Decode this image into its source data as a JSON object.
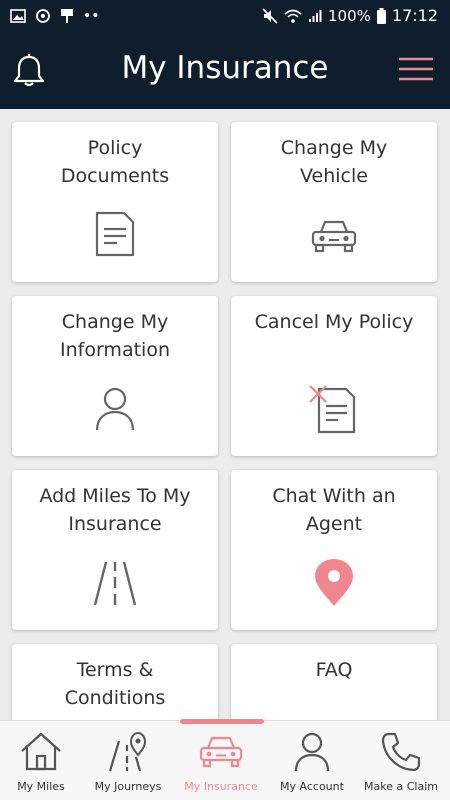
{
  "status_bar": {
    "battery": "100%",
    "time": "17:12"
  },
  "header": {
    "title": "My Insurance"
  },
  "cards": [
    {
      "label": "Policy\nDocuments",
      "icon": "document-icon"
    },
    {
      "label": "Change My\nVehicle",
      "icon": "car-icon"
    },
    {
      "label": "Change My\nInformation",
      "icon": "person-icon"
    },
    {
      "label": "Cancel My Policy",
      "icon": "cancel-document-icon"
    },
    {
      "label": "Add Miles To My\nInsurance",
      "icon": "road-icon"
    },
    {
      "label": "Chat With an\nAgent",
      "icon": "location-pin-icon"
    },
    {
      "label": "Terms &\nConditions",
      "icon": ""
    },
    {
      "label": "FAQ",
      "icon": ""
    }
  ],
  "tabs": [
    {
      "label": "My Miles",
      "icon": "home-icon",
      "active": false
    },
    {
      "label": "My Journeys",
      "icon": "road-pin-icon",
      "active": false
    },
    {
      "label": "My Insurance",
      "icon": "car-icon",
      "active": true
    },
    {
      "label": "My Account",
      "icon": "person-icon",
      "active": false
    },
    {
      "label": "Make a Claim",
      "icon": "phone-icon",
      "active": false
    }
  ],
  "colors": {
    "header_bg": "#0f1e2c",
    "accent": "#f0878e",
    "icon_gray": "#666666",
    "card_bg": "#ffffff",
    "page_bg": "#ececec"
  }
}
